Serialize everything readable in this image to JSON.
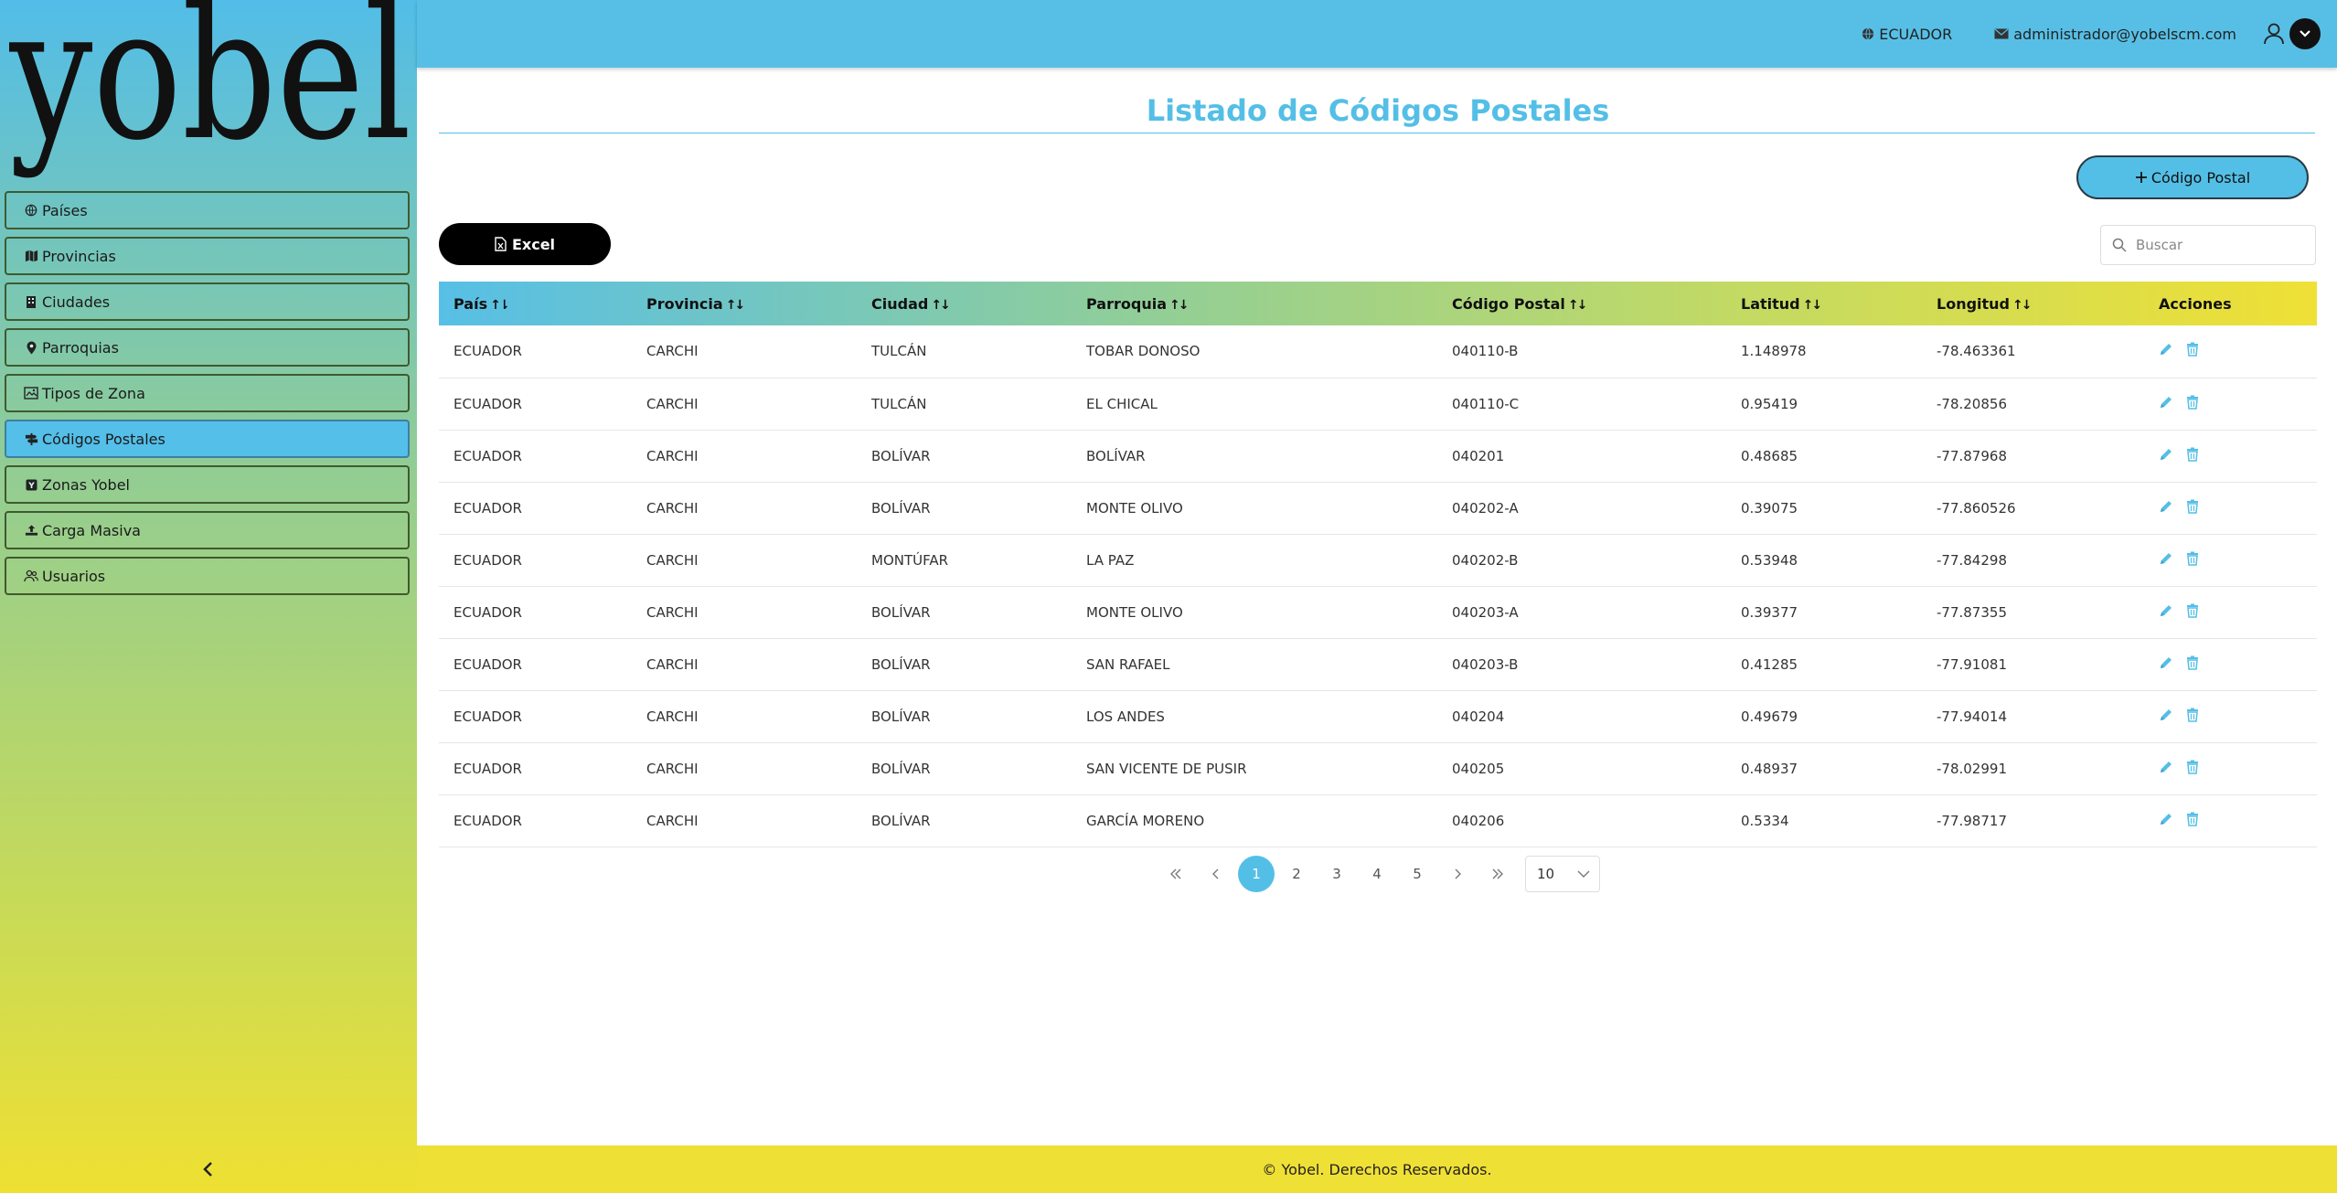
{
  "brand": {
    "logo_text": "yobel"
  },
  "sidebar": {
    "items": [
      {
        "label": "Países",
        "icon": "globe-icon"
      },
      {
        "label": "Provincias",
        "icon": "map-icon"
      },
      {
        "label": "Ciudades",
        "icon": "building-icon"
      },
      {
        "label": "Parroquias",
        "icon": "map-pin-icon"
      },
      {
        "label": "Tipos de Zona",
        "icon": "zone-icon"
      },
      {
        "label": "Códigos Postales",
        "icon": "signpost-icon",
        "active": true
      },
      {
        "label": "Zonas Yobel",
        "icon": "zone-badge-icon"
      },
      {
        "label": "Carga Masiva",
        "icon": "upload-icon"
      },
      {
        "label": "Usuarios",
        "icon": "users-icon"
      }
    ]
  },
  "header": {
    "country": "ECUADOR",
    "email": "administrador@yobelscm.com"
  },
  "page": {
    "title": "Listado de Códigos Postales",
    "add_button": "Código Postal",
    "excel_button": "Excel",
    "search_placeholder": "Buscar"
  },
  "table": {
    "columns": [
      "País",
      "Provincia",
      "Ciudad",
      "Parroquia",
      "Código Postal",
      "Latitud",
      "Longitud",
      "Acciones"
    ],
    "rows": [
      [
        "ECUADOR",
        "CARCHI",
        "TULCÁN",
        "TOBAR DONOSO",
        "040110-B",
        "1.148978",
        "-78.463361"
      ],
      [
        "ECUADOR",
        "CARCHI",
        "TULCÁN",
        "EL CHICAL",
        "040110-C",
        "0.95419",
        "-78.20856"
      ],
      [
        "ECUADOR",
        "CARCHI",
        "BOLÍVAR",
        "BOLÍVAR",
        "040201",
        "0.48685",
        "-77.87968"
      ],
      [
        "ECUADOR",
        "CARCHI",
        "BOLÍVAR",
        "MONTE OLIVO",
        "040202-A",
        "0.39075",
        "-77.860526"
      ],
      [
        "ECUADOR",
        "CARCHI",
        "MONTÚFAR",
        "LA PAZ",
        "040202-B",
        "0.53948",
        "-77.84298"
      ],
      [
        "ECUADOR",
        "CARCHI",
        "BOLÍVAR",
        "MONTE OLIVO",
        "040203-A",
        "0.39377",
        "-77.87355"
      ],
      [
        "ECUADOR",
        "CARCHI",
        "BOLÍVAR",
        "SAN RAFAEL",
        "040203-B",
        "0.41285",
        "-77.91081"
      ],
      [
        "ECUADOR",
        "CARCHI",
        "BOLÍVAR",
        "LOS ANDES",
        "040204",
        "0.49679",
        "-77.94014"
      ],
      [
        "ECUADOR",
        "CARCHI",
        "BOLÍVAR",
        "SAN VICENTE DE PUSIR",
        "040205",
        "0.48937",
        "-78.02991"
      ],
      [
        "ECUADOR",
        "CARCHI",
        "BOLÍVAR",
        "GARCÍA MORENO",
        "040206",
        "0.5334",
        "-77.98717"
      ]
    ]
  },
  "pagination": {
    "pages": [
      "1",
      "2",
      "3",
      "4",
      "5"
    ],
    "current": "1",
    "rows_per_page": "10"
  },
  "footer": {
    "text": "© Yobel. Derechos Reservados."
  },
  "colors": {
    "accent": "#54bfe6",
    "yellow": "#efe035",
    "green": "#93cd92"
  }
}
